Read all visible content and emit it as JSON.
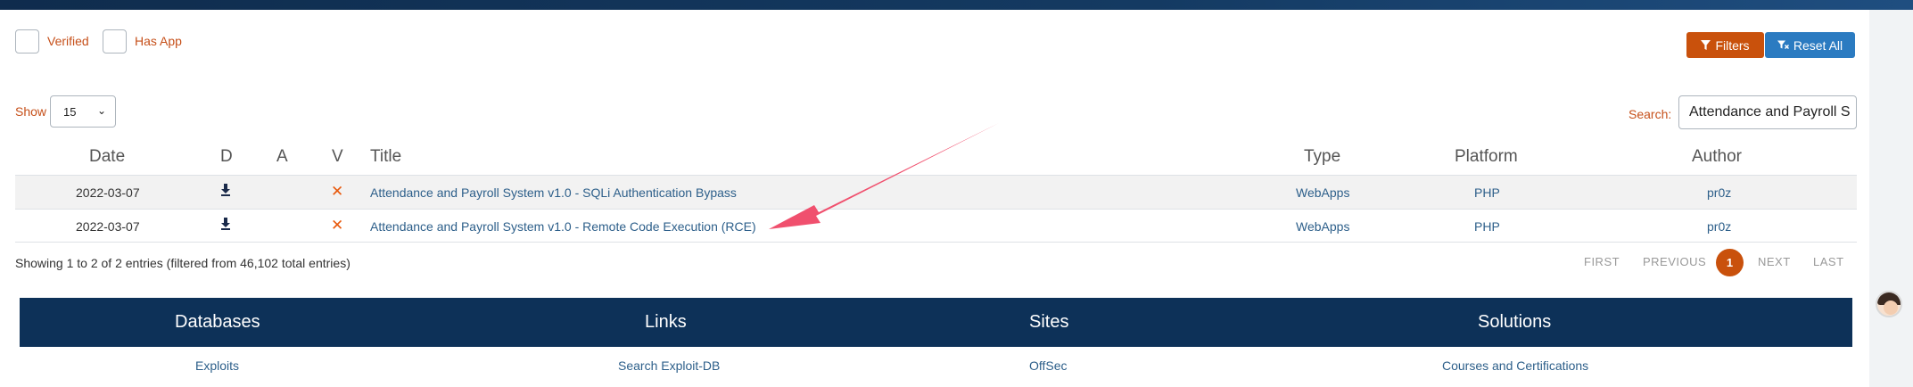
{
  "filters": {
    "verified_label": "Verified",
    "has_app_label": "Has App",
    "filters_button": "Filters",
    "reset_button": "Reset All"
  },
  "controls": {
    "show_label": "Show",
    "show_value": "15",
    "search_label": "Search:",
    "search_value": "Attendance and Payroll S"
  },
  "table": {
    "headers": {
      "date": "Date",
      "d": "D",
      "a": "A",
      "v": "V",
      "title": "Title",
      "type": "Type",
      "platform": "Platform",
      "author": "Author"
    },
    "rows": [
      {
        "date": "2022-03-07",
        "download_icon": "download-icon",
        "verified_icon": "x-icon",
        "title": "Attendance and Payroll System v1.0 - SQLi Authentication Bypass",
        "type": "WebApps",
        "platform": "PHP",
        "author": "pr0z"
      },
      {
        "date": "2022-03-07",
        "download_icon": "download-icon",
        "verified_icon": "x-icon",
        "title": "Attendance and Payroll System v1.0 - Remote Code Execution (RCE)",
        "type": "WebApps",
        "platform": "PHP",
        "author": "pr0z"
      }
    ]
  },
  "pagination": {
    "info": "Showing 1 to 2 of 2 entries (filtered from 46,102 total entries)",
    "first": "FIRST",
    "previous": "PREVIOUS",
    "current": "1",
    "next": "NEXT",
    "last": "LAST"
  },
  "footer": {
    "headings": [
      "Databases",
      "Links",
      "Sites",
      "Solutions"
    ],
    "links": [
      "Exploits",
      "Search Exploit-DB",
      "OffSec",
      "Courses and Certifications"
    ]
  },
  "colors": {
    "accent_orange": "#c9510c",
    "reset_blue": "#2b7bc1",
    "footer_navy": "#0d3158",
    "annotation_arrow": "#f0506e"
  }
}
